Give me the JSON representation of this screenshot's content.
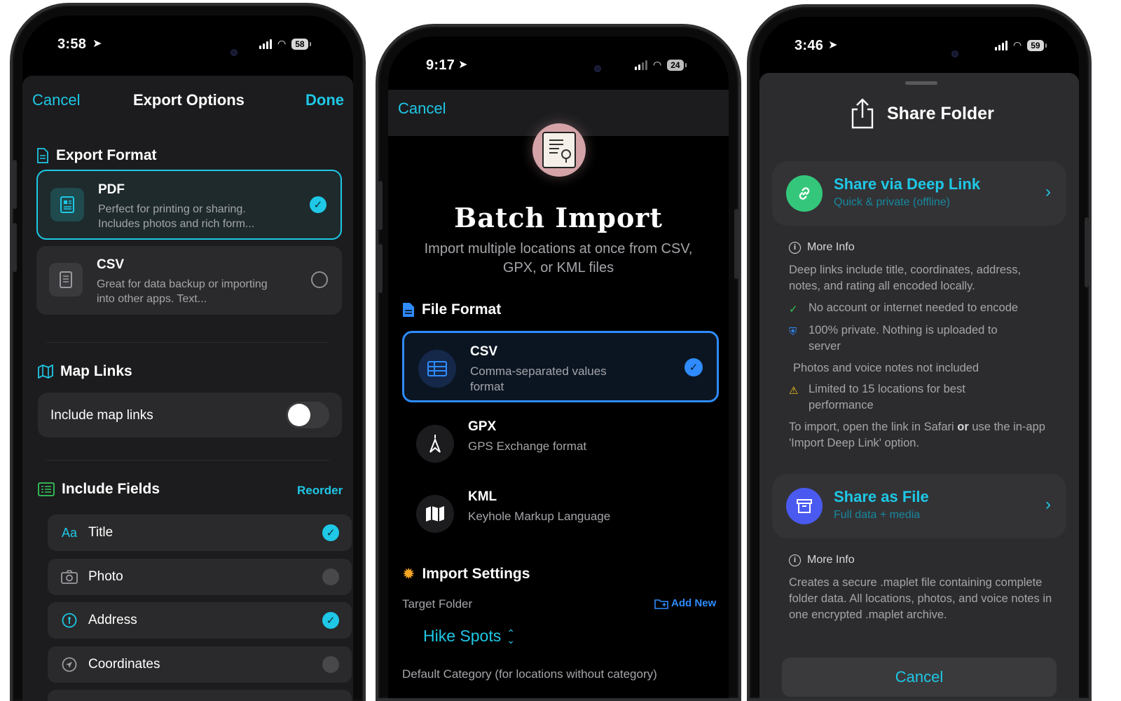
{
  "export_options": {
    "status": {
      "time": "3:58",
      "battery": "58"
    },
    "nav": {
      "cancel": "Cancel",
      "title": "Export Options",
      "done": "Done"
    },
    "export_format": {
      "heading": "Export Format",
      "options": [
        {
          "title": "PDF",
          "desc": "Perfect for printing or sharing. Includes photos and rich form...",
          "selected": true
        },
        {
          "title": "CSV",
          "desc": "Great for data backup or importing into other apps. Text...",
          "selected": false
        }
      ]
    },
    "map_links": {
      "heading": "Map Links",
      "toggle_label": "Include map links",
      "enabled": false
    },
    "include_fields": {
      "heading": "Include Fields",
      "reorder": "Reorder",
      "fields": [
        {
          "icon_text": "Aa",
          "label": "Title",
          "checked": true
        },
        {
          "label": "Photo",
          "checked": false
        },
        {
          "label": "Address",
          "checked": true
        },
        {
          "label": "Coordinates",
          "checked": false
        }
      ]
    }
  },
  "batch_import": {
    "status": {
      "time": "9:17",
      "battery": "24"
    },
    "nav": {
      "cancel": "Cancel"
    },
    "title": "Batch Import",
    "subtitle": "Import multiple locations at once from CSV, GPX, or KML files",
    "file_format": {
      "heading": "File Format",
      "options": [
        {
          "title": "CSV",
          "desc": "Comma-separated values format",
          "selected": true
        },
        {
          "title": "GPX",
          "desc": "GPS Exchange format",
          "selected": false
        },
        {
          "title": "KML",
          "desc": "Keyhole Markup Language",
          "selected": false
        }
      ]
    },
    "import_settings": {
      "heading": "Import Settings",
      "target_folder_label": "Target Folder",
      "add_new": "Add New",
      "target_folder_value": "Hike Spots",
      "default_category_label": "Default Category (for locations without category)"
    }
  },
  "share_folder": {
    "status": {
      "time": "3:46",
      "battery": "59"
    },
    "title": "Share Folder",
    "deep_link": {
      "title": "Share via Deep Link",
      "subtitle": "Quick & private (offline)",
      "more_info": "More Info",
      "desc": "Deep links include title, coordinates, address, notes, and rating all encoded locally.",
      "bullets": [
        "No account or internet needed to encode",
        "100% private. Nothing is uploaded to server",
        "Photos and voice notes not included",
        "Limited to 15 locations for best performance"
      ],
      "import_note_a": "To import, open the link in Safari ",
      "import_note_or": "or",
      "import_note_b": " use the in-app 'Import Deep Link' option."
    },
    "file": {
      "title": "Share as File",
      "subtitle": "Full data + media",
      "more_info": "More Info",
      "desc": "Creates a secure .maplet file containing complete folder data. All locations, photos, and voice notes in one encrypted .maplet archive."
    },
    "cancel": "Cancel"
  },
  "colors": {
    "teal": "#1ec8e6",
    "blue": "#2f8bff",
    "warning": "#f5c518",
    "success": "#34c759"
  }
}
